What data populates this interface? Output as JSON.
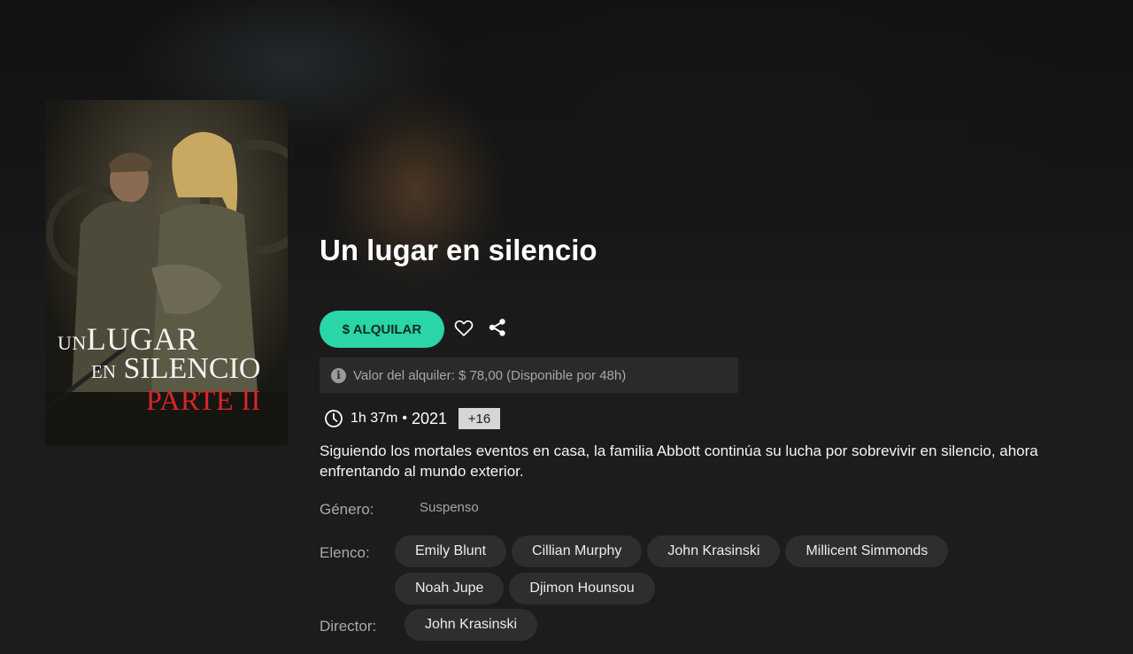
{
  "movie": {
    "title": "Un lugar en silencio",
    "poster": {
      "line1_small": "UN",
      "line1_big": "LUGAR",
      "line2_small": "EN",
      "line2_big": "SILENCIO",
      "line3": "PARTE II"
    },
    "rent_button_label": "$ ALQUILAR",
    "rent_info": "Valor del alquiler: $ 78,00 (Disponible por 48h)",
    "duration": "1h 37m",
    "separator": "•",
    "year": "2021",
    "age_rating": "+16",
    "synopsis": "Siguiendo los mortales eventos en casa, la familia Abbott continúa su lucha por sobrevivir en silencio, ahora enfrentando al mundo exterior.",
    "genre_label": "Género:",
    "genre": "Suspenso",
    "cast_label": "Elenco:",
    "cast": [
      "Emily Blunt",
      "Cillian Murphy",
      "John Krasinski",
      "Millicent Simmonds",
      "Noah Jupe",
      "Djimon Hounsou"
    ],
    "director_label": "Director:",
    "director": "John Krasinski"
  },
  "colors": {
    "accent": "#2ad6a8",
    "background": "#1c1c1c",
    "chip": "#2e2e2e",
    "poster_title_red": "#d8262a"
  },
  "icons": {
    "favorite": "heart-icon",
    "share": "share-icon",
    "info": "info-icon",
    "duration": "clock-icon"
  }
}
